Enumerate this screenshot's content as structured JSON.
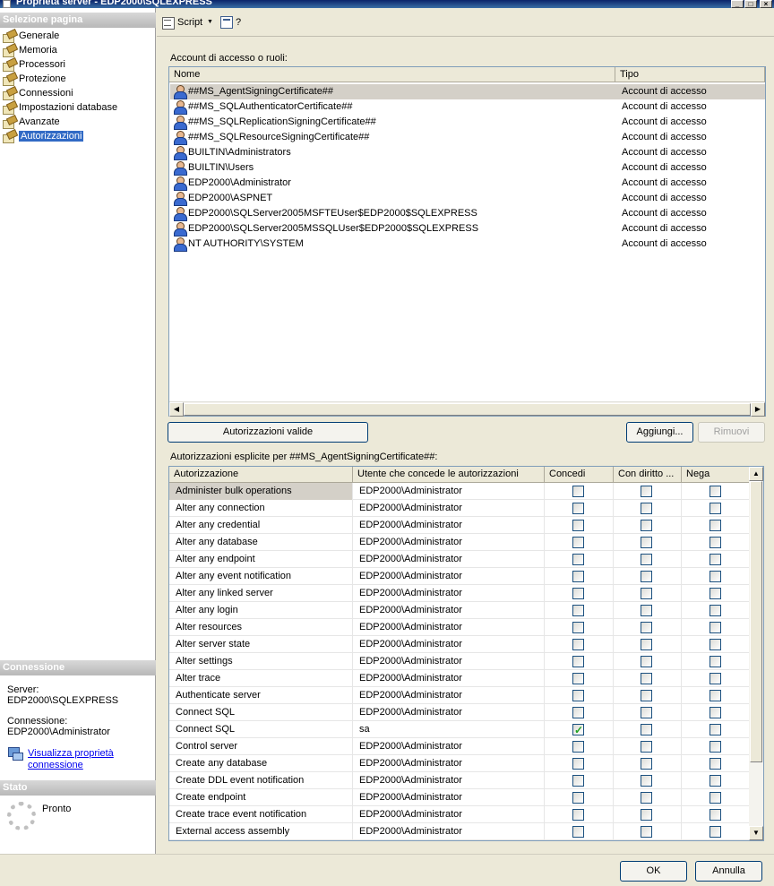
{
  "window": {
    "title": "Proprietà server - EDP2000\\SQLEXPRESS",
    "controls": [
      "_",
      "□",
      "×"
    ]
  },
  "left_pane": {
    "header": "Selezione pagina",
    "items": [
      {
        "label": "Generale"
      },
      {
        "label": "Memoria"
      },
      {
        "label": "Processori"
      },
      {
        "label": "Protezione"
      },
      {
        "label": "Connessioni"
      },
      {
        "label": "Impostazioni database"
      },
      {
        "label": "Avanzate"
      },
      {
        "label": "Autorizzazioni",
        "selected": true
      }
    ]
  },
  "connection": {
    "header": "Connessione",
    "server_label": "Server:",
    "server_value": "EDP2000\\SQLEXPRESS",
    "connection_label": "Connessione:",
    "connection_value": "EDP2000\\Administrator",
    "link_line1": "Visualizza proprietà",
    "link_line2": "connessione"
  },
  "status": {
    "header": "Stato",
    "text": "Pronto"
  },
  "toolbar": {
    "script_label": "Script",
    "script_dropdown": "▼",
    "help_label": "?"
  },
  "logins": {
    "label": "Account di accesso o ruoli:",
    "columns": [
      "Nome",
      "Tipo"
    ],
    "rows": [
      {
        "name": "##MS_AgentSigningCertificate##",
        "type": "Account di accesso",
        "selected": true
      },
      {
        "name": "##MS_SQLAuthenticatorCertificate##",
        "type": "Account di accesso"
      },
      {
        "name": "##MS_SQLReplicationSigningCertificate##",
        "type": "Account di accesso"
      },
      {
        "name": "##MS_SQLResourceSigningCertificate##",
        "type": "Account di accesso"
      },
      {
        "name": "BUILTIN\\Administrators",
        "type": "Account di accesso"
      },
      {
        "name": "BUILTIN\\Users",
        "type": "Account di accesso"
      },
      {
        "name": "EDP2000\\Administrator",
        "type": "Account di accesso"
      },
      {
        "name": "EDP2000\\ASPNET",
        "type": "Account di accesso"
      },
      {
        "name": "EDP2000\\SQLServer2005MSFTEUser$EDP2000$SQLEXPRESS",
        "type": "Account di accesso"
      },
      {
        "name": "EDP2000\\SQLServer2005MSSQLUser$EDP2000$SQLEXPRESS",
        "type": "Account di accesso"
      },
      {
        "name": "NT AUTHORITY\\SYSTEM",
        "type": "Account di accesso"
      }
    ],
    "scroll_left": "◀",
    "scroll_right": "▶"
  },
  "buttons": {
    "effective": "Autorizzazioni valide",
    "add": "Aggiungi...",
    "remove": "Rimuovi",
    "ok": "OK",
    "cancel": "Annulla"
  },
  "permissions": {
    "label": "Autorizzazioni esplicite per ##MS_AgentSigningCertificate##:",
    "columns": [
      "Autorizzazione",
      "Utente che concede le autorizzazioni",
      "Concedi",
      "Con diritto ...",
      "Nega"
    ],
    "scroll_up": "▲",
    "scroll_down": "▼",
    "rows": [
      {
        "perm": "Administer bulk operations",
        "grantor": "EDP2000\\Administrator",
        "grant": false,
        "with_grant": false,
        "deny": false,
        "selected": true
      },
      {
        "perm": "Alter any connection",
        "grantor": "EDP2000\\Administrator",
        "grant": false,
        "with_grant": false,
        "deny": false
      },
      {
        "perm": "Alter any credential",
        "grantor": "EDP2000\\Administrator",
        "grant": false,
        "with_grant": false,
        "deny": false
      },
      {
        "perm": "Alter any database",
        "grantor": "EDP2000\\Administrator",
        "grant": false,
        "with_grant": false,
        "deny": false
      },
      {
        "perm": "Alter any endpoint",
        "grantor": "EDP2000\\Administrator",
        "grant": false,
        "with_grant": false,
        "deny": false
      },
      {
        "perm": "Alter any event notification",
        "grantor": "EDP2000\\Administrator",
        "grant": false,
        "with_grant": false,
        "deny": false
      },
      {
        "perm": "Alter any linked server",
        "grantor": "EDP2000\\Administrator",
        "grant": false,
        "with_grant": false,
        "deny": false
      },
      {
        "perm": "Alter any login",
        "grantor": "EDP2000\\Administrator",
        "grant": false,
        "with_grant": false,
        "deny": false
      },
      {
        "perm": "Alter resources",
        "grantor": "EDP2000\\Administrator",
        "grant": false,
        "with_grant": false,
        "deny": false
      },
      {
        "perm": "Alter server state",
        "grantor": "EDP2000\\Administrator",
        "grant": false,
        "with_grant": false,
        "deny": false
      },
      {
        "perm": "Alter settings",
        "grantor": "EDP2000\\Administrator",
        "grant": false,
        "with_grant": false,
        "deny": false
      },
      {
        "perm": "Alter trace",
        "grantor": "EDP2000\\Administrator",
        "grant": false,
        "with_grant": false,
        "deny": false
      },
      {
        "perm": "Authenticate server",
        "grantor": "EDP2000\\Administrator",
        "grant": false,
        "with_grant": false,
        "deny": false
      },
      {
        "perm": "Connect SQL",
        "grantor": "EDP2000\\Administrator",
        "grant": false,
        "with_grant": false,
        "deny": false
      },
      {
        "perm": "Connect SQL",
        "grantor": "sa",
        "grant": true,
        "with_grant": false,
        "deny": false
      },
      {
        "perm": "Control server",
        "grantor": "EDP2000\\Administrator",
        "grant": false,
        "with_grant": false,
        "deny": false
      },
      {
        "perm": "Create any database",
        "grantor": "EDP2000\\Administrator",
        "grant": false,
        "with_grant": false,
        "deny": false
      },
      {
        "perm": "Create DDL event notification",
        "grantor": "EDP2000\\Administrator",
        "grant": false,
        "with_grant": false,
        "deny": false
      },
      {
        "perm": "Create endpoint",
        "grantor": "EDP2000\\Administrator",
        "grant": false,
        "with_grant": false,
        "deny": false
      },
      {
        "perm": "Create trace event notification",
        "grantor": "EDP2000\\Administrator",
        "grant": false,
        "with_grant": false,
        "deny": false
      },
      {
        "perm": "External access assembly",
        "grantor": "EDP2000\\Administrator",
        "grant": false,
        "with_grant": false,
        "deny": false
      }
    ]
  }
}
